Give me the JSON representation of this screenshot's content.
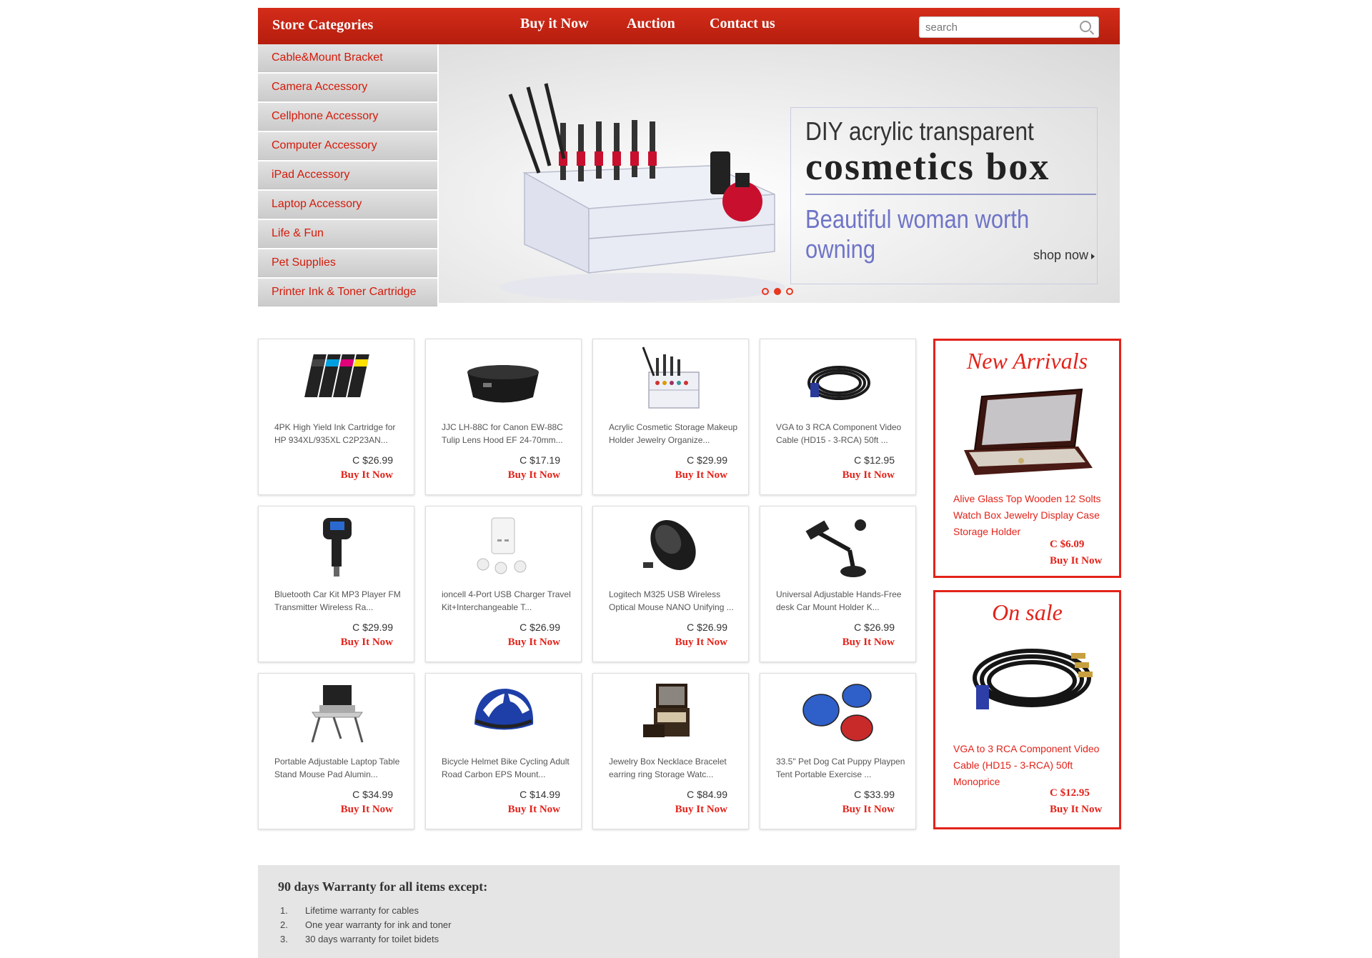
{
  "header": {
    "store_categories": "Store Categories",
    "nav": [
      "Buy it Now",
      "Auction",
      "Contact us"
    ],
    "search_placeholder": "search"
  },
  "sidebar": {
    "items": [
      "Cable&Mount Bracket",
      "Camera Accessory",
      "Cellphone Accessory",
      "Computer Accessory",
      "iPad Accessory",
      "Laptop Accessory",
      "Life & Fun",
      "Pet Supplies",
      "Printer Ink & Toner Cartridge"
    ]
  },
  "banner": {
    "line1": "DIY acrylic transparent",
    "line2": "cosmetics box",
    "line3": "Beautiful woman worth owning",
    "cta": "shop  now",
    "slides": 3,
    "active_slide": 2
  },
  "products": [
    {
      "title": "4PK High Yield Ink Cartridge for HP 934XL/935XL C2P23AN...",
      "price": "C $26.99",
      "buy": "Buy It Now",
      "icon": "ink-cartridges-icon"
    },
    {
      "title": "JJC LH-88C for Canon EW-88C Tulip Lens Hood EF 24-70mm...",
      "price": "C $17.19",
      "buy": "Buy It Now",
      "icon": "lens-hood-icon"
    },
    {
      "title": "Acrylic Cosmetic Storage Makeup Holder Jewelry Organize...",
      "price": "C $29.99",
      "buy": "Buy It Now",
      "icon": "cosmetic-organizer-icon"
    },
    {
      "title": "VGA to 3 RCA Component Video Cable (HD15 - 3-RCA) 50ft ...",
      "price": "C $12.95",
      "buy": "Buy It Now",
      "icon": "cable-icon"
    },
    {
      "title": "Bluetooth Car Kit MP3 Player FM Transmitter Wireless Ra...",
      "price": "C $29.99",
      "buy": "Buy It Now",
      "icon": "fm-transmitter-icon"
    },
    {
      "title": "ioncell 4-Port USB Charger Travel Kit+Interchangeable T...",
      "price": "C $26.99",
      "buy": "Buy It Now",
      "icon": "usb-charger-icon"
    },
    {
      "title": "Logitech M325 USB Wireless Optical Mouse NANO Unifying ...",
      "price": "C $26.99",
      "buy": "Buy It Now",
      "icon": "mouse-icon"
    },
    {
      "title": "Universal Adjustable Hands-Free desk Car Mount Holder K...",
      "price": "C $26.99",
      "buy": "Buy It Now",
      "icon": "car-mount-icon"
    },
    {
      "title": "Portable Adjustable Laptop Table Stand Mouse Pad Alumin...",
      "price": "C $34.99",
      "buy": "Buy It Now",
      "icon": "laptop-table-icon"
    },
    {
      "title": "Bicycle Helmet Bike Cycling Adult Road Carbon EPS Mount...",
      "price": "C $14.99",
      "buy": "Buy It Now",
      "icon": "helmet-icon"
    },
    {
      "title": "Jewelry Box Necklace Bracelet earring ring Storage Watc...",
      "price": "C $84.99",
      "buy": "Buy It Now",
      "icon": "jewelry-box-icon"
    },
    {
      "title": "33.5\" Pet Dog Cat Puppy Playpen Tent Portable Exercise ...",
      "price": "C $33.99",
      "buy": "Buy It Now",
      "icon": "playpen-icon"
    }
  ],
  "new_arrivals": {
    "heading": "New Arrivals",
    "title": "Alive Glass Top Wooden 12 Solts Watch Box Jewelry Display Case Storage Holder",
    "price": "C $6.09",
    "buy": "Buy It Now",
    "icon": "watch-box-icon"
  },
  "on_sale": {
    "heading": "On sale",
    "title": "VGA to 3 RCA Component Video Cable (HD15 - 3-RCA) 50ft Monoprice",
    "price": "C $12.95",
    "buy": "Buy It Now",
    "icon": "cable-icon"
  },
  "warranty": {
    "title": "90 days Warranty for all items except:",
    "items": [
      {
        "num": "1.",
        "text": "Lifetime warranty for cables"
      },
      {
        "num": "2.",
        "text": "One year warranty for ink and toner"
      },
      {
        "num": "3.",
        "text": "30 days warranty for toilet bidets"
      }
    ]
  },
  "colors": {
    "accent": "#e2231a",
    "header": "#c4250f",
    "sidebar": "#d6d6d6",
    "footer": "#e5e5e5"
  }
}
